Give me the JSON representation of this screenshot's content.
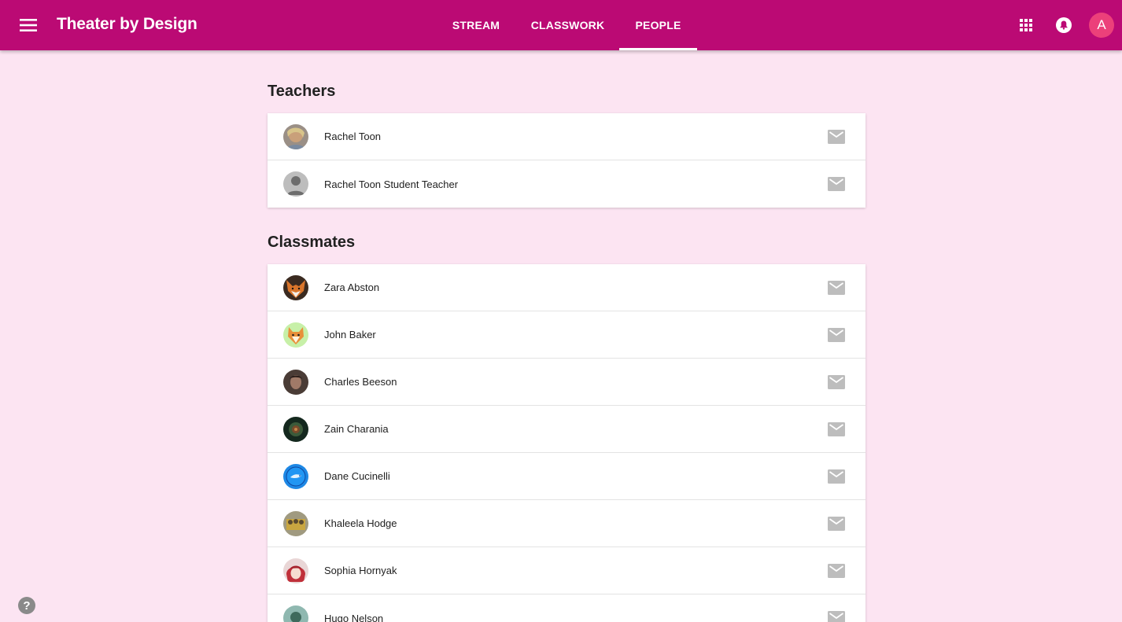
{
  "header": {
    "title": "Theater by Design",
    "tabs": [
      {
        "label": "STREAM"
      },
      {
        "label": "CLASSWORK"
      },
      {
        "label": "PEOPLE",
        "active": true
      }
    ],
    "account_initial": "A",
    "icons": [
      "menu-icon",
      "apps-grid-icon",
      "notifications-icon"
    ]
  },
  "teachers": {
    "title": "Teachers",
    "people": [
      {
        "name": "Rachel Toon",
        "avatar": "photo"
      },
      {
        "name": "Rachel Toon Student Teacher",
        "avatar": "default-silhouette"
      }
    ]
  },
  "classmates": {
    "title": "Classmates",
    "people": [
      {
        "name": "Zara Abston",
        "avatar": "fox"
      },
      {
        "name": "John Baker",
        "avatar": "shiba-dog"
      },
      {
        "name": "Charles Beeson",
        "avatar": "photo"
      },
      {
        "name": "Zain Charania",
        "avatar": "photo"
      },
      {
        "name": "Dane Cucinelli",
        "avatar": "blue-bird"
      },
      {
        "name": "Khaleela Hodge",
        "avatar": "photo"
      },
      {
        "name": "Sophia Hornyak",
        "avatar": "red-hair-character"
      },
      {
        "name": "Hugo Nelson",
        "avatar": "photo"
      }
    ]
  },
  "colors": {
    "brand": "#bb0a74",
    "background": "#fce4f2",
    "account_avatar": "#ec407a"
  },
  "help_label": "?"
}
